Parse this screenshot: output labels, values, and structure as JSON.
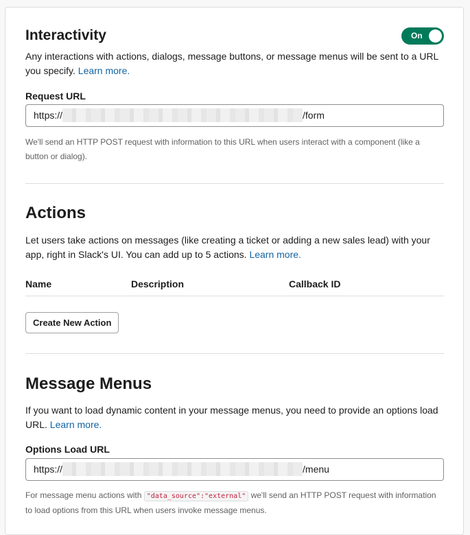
{
  "interactivity": {
    "title": "Interactivity",
    "toggle_label": "On",
    "description": "Any interactions with actions, dialogs, message buttons, or message menus will be sent to a URL you specify.",
    "learn_more": "Learn more.",
    "request_url_label": "Request URL",
    "request_url_prefix": "https://",
    "request_url_suffix": "/form",
    "help": "We'll send an HTTP POST request with information to this URL when users interact with a component (like a button or dialog)."
  },
  "actions": {
    "title": "Actions",
    "description": "Let users take actions on messages (like creating a ticket or adding a new sales lead) with your app, right in Slack's UI. You can add up to 5 actions.",
    "learn_more": "Learn more.",
    "columns": [
      "Name",
      "Description",
      "Callback ID"
    ],
    "create_button": "Create New Action"
  },
  "message_menus": {
    "title": "Message Menus",
    "description": "If you want to load dynamic content in your message menus, you need to provide an options load URL.",
    "learn_more": "Learn more.",
    "options_url_label": "Options Load URL",
    "options_url_prefix": "https://",
    "options_url_suffix": "/menu",
    "help_before": "For message menu actions with",
    "help_code": "\"data_source\":\"external\"",
    "help_after": "we'll send an HTTP POST request with information to load options from this URL when users invoke message menus."
  },
  "colors": {
    "toggle_on": "#007a5a",
    "link": "#1264a3",
    "code": "#c0213d"
  }
}
